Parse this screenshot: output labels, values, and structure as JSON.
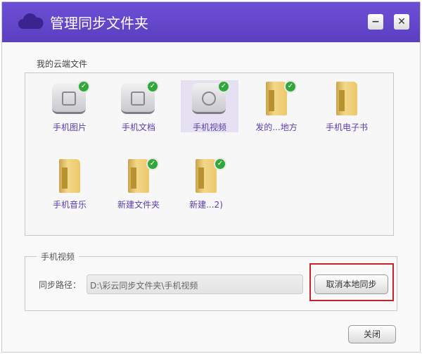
{
  "window": {
    "title": "管理同步文件夹",
    "minimize_label": "−",
    "close_label": "✕"
  },
  "files": {
    "section_label": "我的云端文件",
    "items": [
      {
        "label": "手机图片",
        "icon": "photo-app-icon",
        "synced": true
      },
      {
        "label": "手机文档",
        "icon": "document-app-icon",
        "synced": true
      },
      {
        "label": "手机视频",
        "icon": "video-app-icon",
        "synced": true,
        "selected": true
      },
      {
        "label": "发的...地方",
        "icon": "folder-icon",
        "synced": true
      },
      {
        "label": "手机电子书",
        "icon": "folder-icon",
        "synced": false
      },
      {
        "label": "手机音乐",
        "icon": "folder-icon",
        "synced": false
      },
      {
        "label": "新建文件夹",
        "icon": "folder-icon",
        "synced": true
      },
      {
        "label": "新建...2)",
        "icon": "folder-icon",
        "synced": true
      }
    ]
  },
  "detail": {
    "legend": "手机视频",
    "path_label": "同步路径：",
    "path_value": "D:\\彩云同步文件夹\\手机视频",
    "cancel_sync_label": "取消本地同步"
  },
  "footer": {
    "close_label": "关闭"
  },
  "colors": {
    "title_bar": "#5f42c6",
    "highlight": "#c8232c",
    "check": "#32a83a"
  }
}
